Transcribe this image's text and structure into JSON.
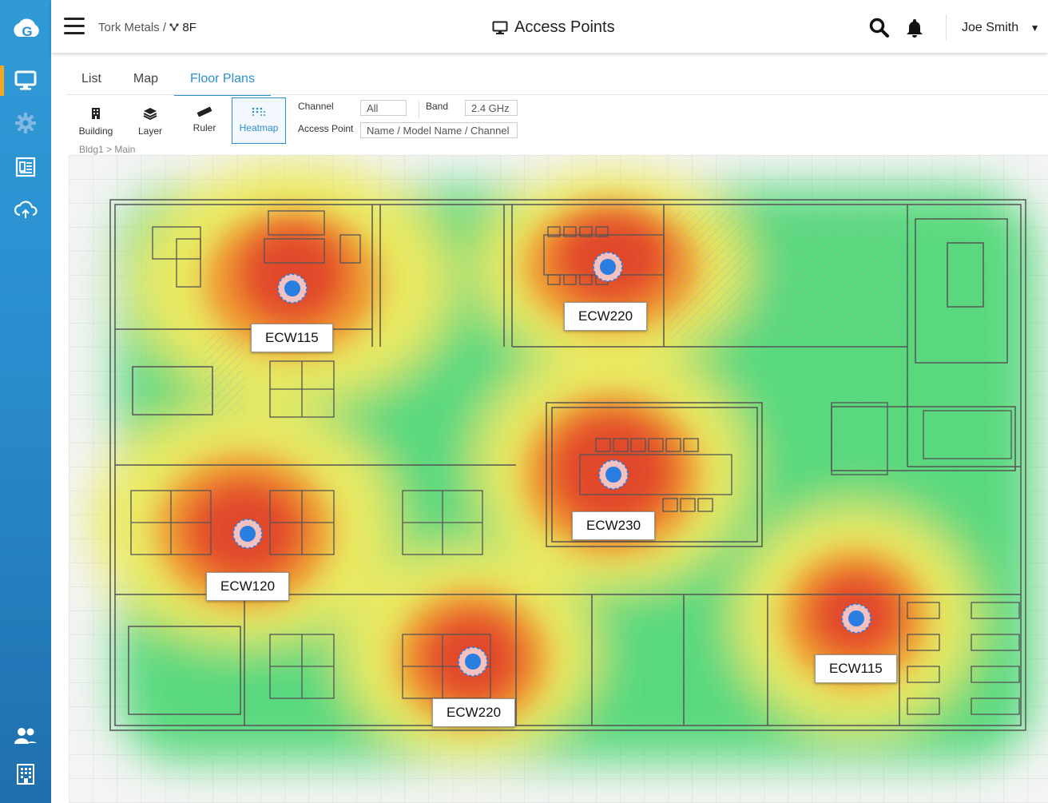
{
  "app": {
    "logo_letter": "G"
  },
  "sidebar": {
    "items": [
      {
        "icon": "monitor-icon",
        "active": true
      },
      {
        "icon": "gear-icon",
        "active": false
      },
      {
        "icon": "report-icon",
        "active": false
      },
      {
        "icon": "cloud-sync-icon",
        "active": false
      },
      {
        "icon": "users-icon",
        "active": false
      },
      {
        "icon": "building-icon",
        "active": false
      }
    ]
  },
  "header": {
    "breadcrumb_org": "Tork Metals /",
    "breadcrumb_site": "8F",
    "title": "Access Points",
    "user_name": "Joe Smith"
  },
  "tabs": [
    {
      "label": "List",
      "active": false
    },
    {
      "label": "Map",
      "active": false
    },
    {
      "label": "Floor Plans",
      "active": true
    }
  ],
  "toolbar": {
    "building": "Building",
    "layer": "Layer",
    "ruler": "Ruler",
    "heatmap": "Heatmap",
    "channel_label": "Channel",
    "channel_value": "All",
    "band_label": "Band",
    "band_value": "2.4 GHz",
    "ap_label": "Access Point",
    "ap_placeholder": "Name / Model Name / Channel"
  },
  "location_path": "Bldg1 > Main",
  "access_points": [
    {
      "name": "ECW115"
    },
    {
      "name": "ECW220"
    },
    {
      "name": "ECW230"
    },
    {
      "name": "ECW120"
    },
    {
      "name": "ECW220"
    },
    {
      "name": "ECW115"
    }
  ],
  "colors": {
    "accent": "#2d8fd0",
    "sidebar": "#2b8fcf",
    "active_marker": "#f5a623",
    "ap_dot": "#2a7de1"
  }
}
